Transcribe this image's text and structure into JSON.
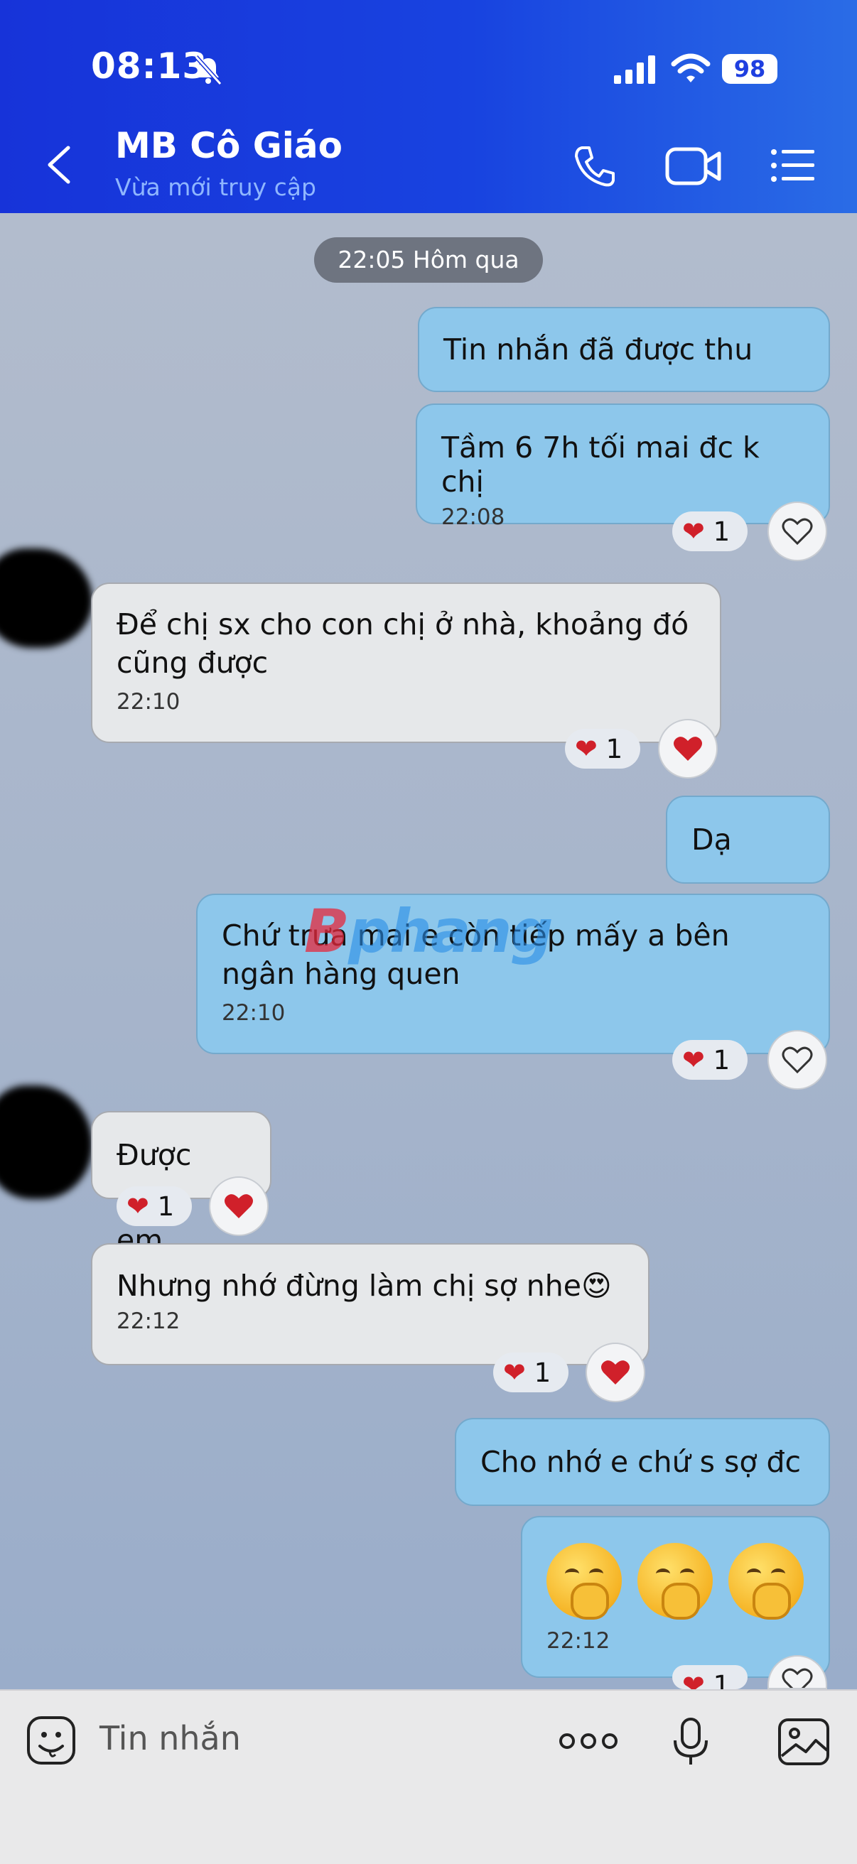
{
  "status_bar": {
    "time": "08:13",
    "battery": "98"
  },
  "header": {
    "contact_name": "MB Cô Giáo",
    "contact_status": "Vừa mới truy cập"
  },
  "chat": {
    "date_divider": "22:05 Hôm qua",
    "messages": [
      {
        "side": "mine",
        "text": "Tin nhắn đã được thu hồi"
      },
      {
        "side": "mine",
        "text": "Tầm 6 7h tối mai đc k chị",
        "time": "22:08",
        "reaction_count": "1"
      },
      {
        "side": "theirs",
        "text": "Để chị sx cho con chị ở nhà, khoảng đó cũng được",
        "time": "22:10",
        "reaction_count": "1"
      },
      {
        "side": "mine",
        "text": "Dạ"
      },
      {
        "side": "mine",
        "text": "Chứ trưa mai e còn tiếp mấy a bên ngân hàng quen",
        "time": "22:10",
        "reaction_count": "1"
      },
      {
        "side": "theirs",
        "text": "Được em",
        "reaction_count": "1"
      },
      {
        "side": "theirs",
        "text": "Nhưng nhớ đừng làm chị sợ nhe😍",
        "time": "22:12",
        "reaction_count": "1"
      },
      {
        "side": "mine",
        "text": "Cho nhớ e chứ s sợ đc"
      },
      {
        "side": "mine",
        "text": "",
        "emoji_count": "3",
        "time": "22:12",
        "reaction_count": "1"
      }
    ]
  },
  "watermark": {
    "part1": "B",
    "part2": "phang"
  },
  "composer": {
    "placeholder": "Tin nhắn"
  },
  "icons": {
    "bell": "bell-slash-icon",
    "signal": "signal-icon",
    "wifi": "wifi-icon",
    "back": "back-arrow-icon",
    "phone": "phone-icon",
    "video": "video-call-icon",
    "menu": "list-menu-icon",
    "heart": "heart-icon",
    "sticker": "sticker-icon",
    "more": "more-dots-icon",
    "mic": "microphone-icon",
    "image": "image-icon"
  },
  "colors": {
    "header": "#1a3ce0",
    "mine_bubble": "#8dc7eb",
    "theirs_bubble": "#e6e8ea",
    "heart": "#d0202a"
  }
}
